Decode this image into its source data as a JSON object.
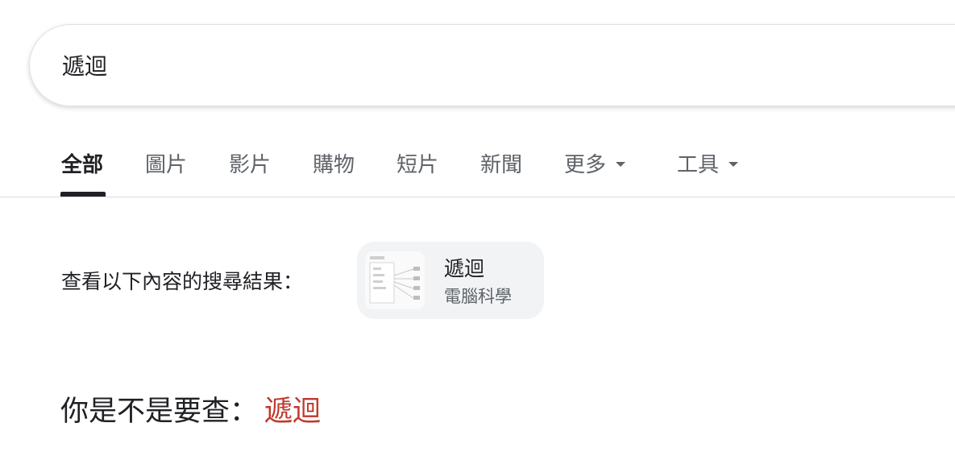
{
  "search": {
    "query": "遞迴"
  },
  "tabs": [
    {
      "label": "全部",
      "active": true
    },
    {
      "label": "圖片"
    },
    {
      "label": "影片"
    },
    {
      "label": "購物"
    },
    {
      "label": "短片"
    },
    {
      "label": "新聞"
    },
    {
      "label": "更多",
      "has_dropdown": true
    },
    {
      "label": "工具",
      "has_dropdown": true
    }
  ],
  "see_results": {
    "label": "查看以下內容的搜尋結果：",
    "entity_title": "遞迴",
    "entity_subtitle": "電腦科學",
    "thumbnail_icon": "diagram-thumbnail"
  },
  "did_you_mean": {
    "prefix": "你是不是要查：",
    "suggestion": "遞迴"
  },
  "colors": {
    "suggestion_link": "#c0392b",
    "active_tab": "#202124",
    "inactive_tab": "#5f6368",
    "chip_background": "#f1f3f4"
  }
}
